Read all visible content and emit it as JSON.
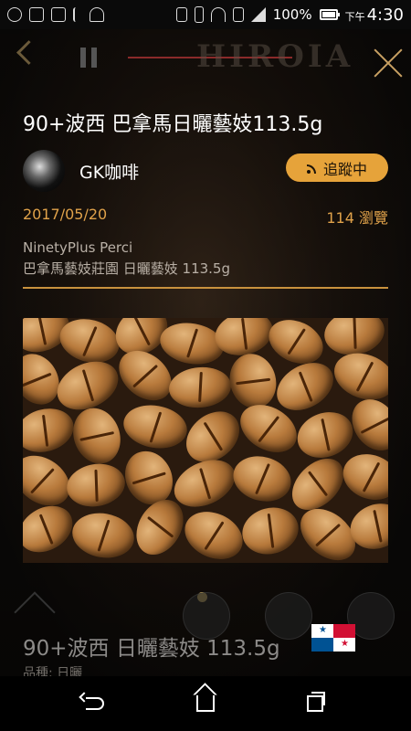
{
  "status_bar": {
    "battery": "100%",
    "ampm": "下午",
    "time": "4:30",
    "icons": [
      "app-icon",
      "code-icon",
      "code-icon",
      "usb-icon",
      "android-icon",
      "nfc-icon",
      "vibrate-icon",
      "wifi-icon",
      "sim-icon",
      "signal-icon",
      "battery-icon"
    ]
  },
  "topbar": {
    "brand": "HIROIA",
    "icons": [
      "chevron-left-icon",
      "pause-icon",
      "close-icon"
    ]
  },
  "post": {
    "title": "90+波西 巴拿馬日曬藝妓113.5g",
    "author": "GK咖啡",
    "follow_label": "追蹤中",
    "date": "2017/05/20",
    "views": "114 瀏覽",
    "subtitle_line1": "NinetyPlus Perci",
    "subtitle_line2": "巴拿馬藝妓莊園 日曬藝妓 113.5g"
  },
  "product": {
    "title": "90+波西 日曬藝妓 113.5g",
    "variety": "品種: 日曬",
    "flag": "panama-flag"
  },
  "colors": {
    "accent": "#e6a33a",
    "divider": "#c9923e",
    "close": "#c8a062"
  },
  "navbar": {
    "icons": [
      "back-icon",
      "home-icon",
      "recent-apps-icon"
    ]
  }
}
